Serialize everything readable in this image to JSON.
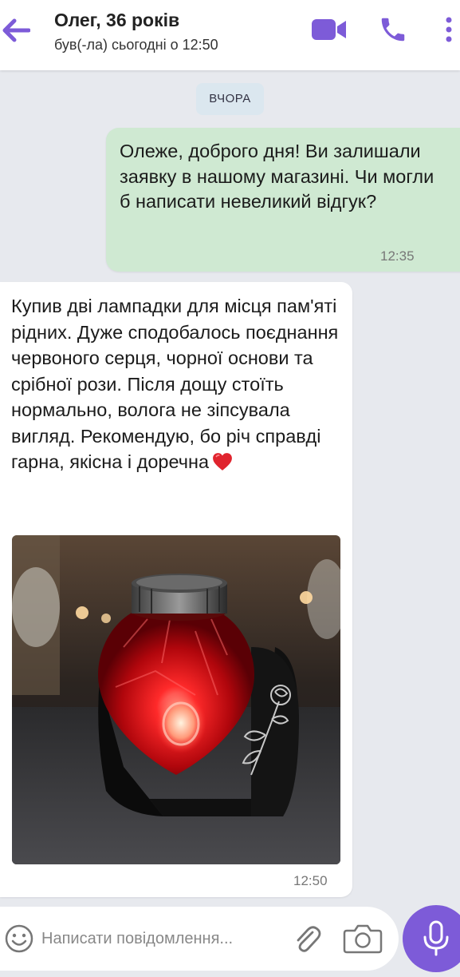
{
  "header": {
    "contact_name": "Олег, 36 років",
    "last_seen": "був(-ла) сьогодні о 12:50",
    "icons": {
      "back": "arrow-left-icon",
      "video": "video-camera-icon",
      "call": "phone-icon",
      "more": "more-vertical-icon"
    }
  },
  "chat": {
    "date_separator": "ВЧОРА",
    "messages": [
      {
        "direction": "outgoing",
        "text": "Олеже, доброго дня! Ви залишали заявку в нашому магазині. Чи могли б написати невеликий відгук?",
        "time": "12:35"
      },
      {
        "direction": "incoming",
        "text": "Купив дві лампадки для місця пам'яті рідних. Дуже сподобалось поєднання червоного серця, чорної основи та срібної рози. Після дощу стоїть нормально, волога не зіпсувала вигляд. Рекомендую, бо річ справді гарна, якісна і доречна",
        "emoji": "red-heart-icon",
        "attachment": "photo",
        "time": "12:50"
      }
    ]
  },
  "composer": {
    "placeholder": "Написати повідомлення...",
    "icons": {
      "emoji": "smiley-icon",
      "attach": "paperclip-icon",
      "camera": "camera-icon",
      "mic": "microphone-icon"
    }
  },
  "colors": {
    "accent": "#7d5bd8",
    "outgoing_bubble": "#cfe9d2",
    "incoming_bubble": "#ffffff",
    "chat_background": "#e7e9ee",
    "date_chip": "#dbe7ef"
  }
}
